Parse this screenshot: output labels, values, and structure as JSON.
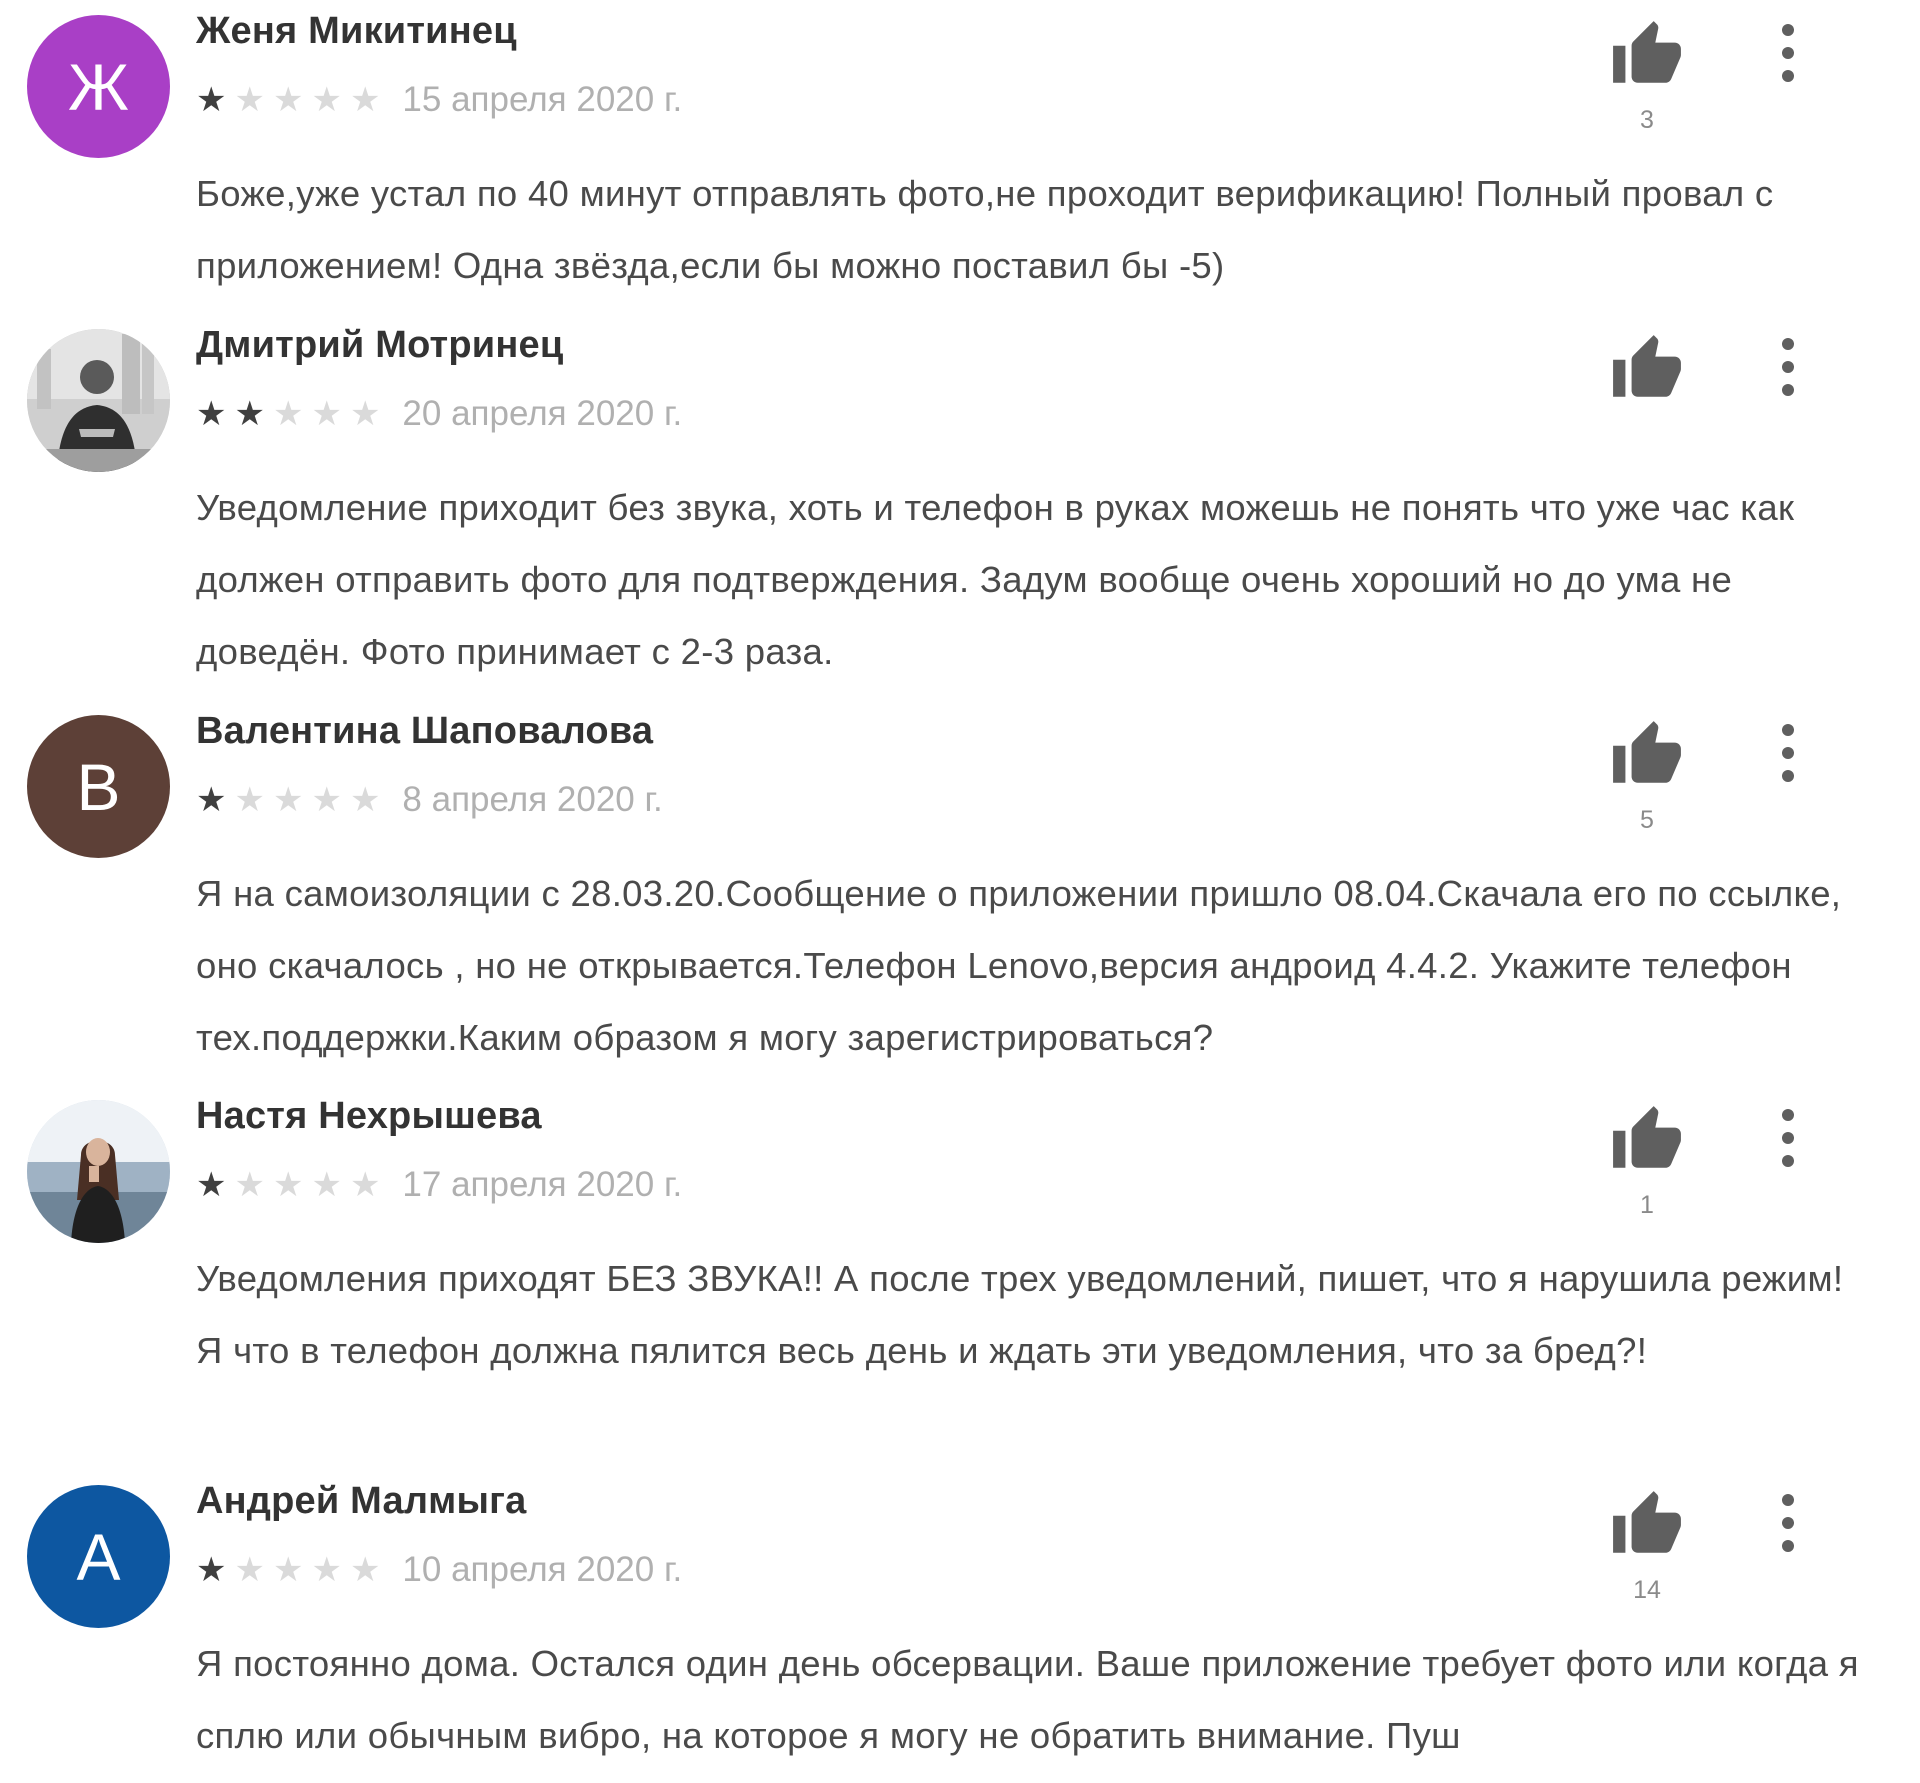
{
  "reviews": [
    {
      "author": "Женя Микитинец",
      "avatar_letter": "Ж",
      "avatar_color": "#a93fc6",
      "avatar_type": "letter",
      "rating": 1,
      "date": "15 апреля 2020 г.",
      "likes": "3",
      "text": "Боже,уже устал по 40 минут отправлять фото,не проходит верификацию! Полный провал с приложением! Одна звёзда,если бы можно поставил бы -5)"
    },
    {
      "author": "Дмитрий Мотринец",
      "avatar_type": "photo",
      "rating": 2,
      "date": "20 апреля 2020 г.",
      "likes": "",
      "text": "Уведомление приходит без звука, хоть и телефон в руках можешь не понять что уже час как должен отправить фото для подтверждения. Задум вообще очень хороший но до ума не доведён. Фото принимает с 2-3 раза."
    },
    {
      "author": "Валентина Шаповалова",
      "avatar_letter": "В",
      "avatar_color": "#5d4037",
      "avatar_type": "letter",
      "rating": 1,
      "date": "8 апреля 2020 г.",
      "likes": "5",
      "text": "Я на самоизоляции с 28.03.20.Сообщение о приложении пришло 08.04.Скачала его по ссылке, оно скачалось , но не открывается.Телефон Lenovo,версия андроид 4.4.2. Укажите телефон тех.поддержки.Каким образом я могу зарегистрироваться?"
    },
    {
      "author": "Настя Нехрышева",
      "avatar_type": "photo",
      "rating": 1,
      "date": "17 апреля 2020 г.",
      "likes": "1",
      "text": "Уведомления приходят БЕЗ ЗВУКА!! А после трех уведомлений, пишет, что я нарушила режим! Я что в телефон должна пялится весь день и ждать эти уведомления, что за бред?!"
    },
    {
      "author": "Андрей Малмыга",
      "avatar_letter": "А",
      "avatar_color": "#0d57a1",
      "avatar_type": "letter",
      "rating": 1,
      "date": "10 апреля 2020 г.",
      "likes": "14",
      "text": "Я постоянно дома. Остался один день обсервации. Ваше приложение требует фото или когда я сплю или обычным вибро, на которое я могу не обратить внимание. Пуш"
    }
  ],
  "colors": {
    "star_filled": "#404040",
    "star_empty": "#dadada",
    "icon": "#5f5f5f"
  }
}
